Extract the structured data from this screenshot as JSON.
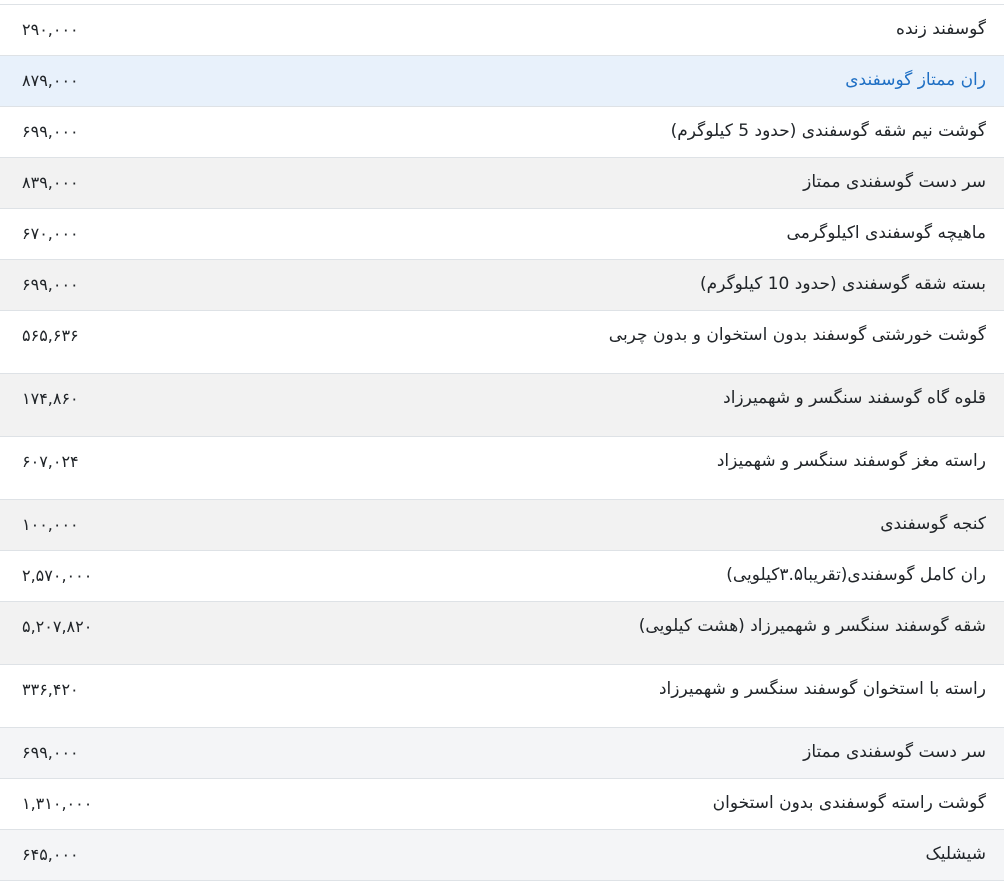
{
  "rows": [
    {
      "name": "گوسفند زنده",
      "price": "۲۹۰,۰۰۰"
    },
    {
      "name": "ران ممتاز گوسفندی",
      "price": "۸۷۹,۰۰۰"
    },
    {
      "name": "گوشت نیم شقه گوسفندی (حدود 5 کیلوگرم)",
      "price": "۶۹۹,۰۰۰"
    },
    {
      "name": "سر دست گوسفندی ممتاز",
      "price": "۸۳۹,۰۰۰"
    },
    {
      "name": "ماهیچه گوسفندی اکیلوگرمی",
      "price": "۶۷۰,۰۰۰"
    },
    {
      "name": "بسته شقه گوسفندی (حدود 10 کیلوگرم)",
      "price": "۶۹۹,۰۰۰"
    },
    {
      "name": "گوشت خورشتی گوسفند بدون استخوان و بدون چربی",
      "price": "۵۶۵,۶۳۶"
    },
    {
      "name": "قلوه گاه گوسفند سنگسر و شهمیرزاد",
      "price": "۱۷۴,۸۶۰"
    },
    {
      "name": "راسته مغز گوسفند سنگسر و شهمیزاد",
      "price": "۶۰۷,۰۲۴"
    },
    {
      "name": "کنجه گوسفندی",
      "price": "۱۰۰,۰۰۰"
    },
    {
      "name": "ران کامل گوسفندی(تقریبا۳.۵کیلویی)",
      "price": "۲,۵۷۰,۰۰۰"
    },
    {
      "name": "شقه گوسفند سنگسر و شهمیرزاد (هشت کیلویی)",
      "price": "۵,۲۰۷,۸۲۰"
    },
    {
      "name": "راسته با استخوان گوسفند سنگسر و شهمیرزاد",
      "price": "۳۳۶,۴۲۰"
    },
    {
      "name": "سر دست گوسفندی ممتاز",
      "price": "۶۹۹,۰۰۰"
    },
    {
      "name": "گوشت راسته گوسفندی بدون استخوان",
      "price": "۱,۳۱۰,۰۰۰"
    },
    {
      "name": "شیشلیک",
      "price": "۶۴۵,۰۰۰"
    }
  ],
  "colors": {
    "border": "#dee2e6",
    "stripe": "#f2f2f2",
    "highlight_bg": "#e8f1fb",
    "highlight_text": "#1e6fc4",
    "text": "#212529"
  }
}
